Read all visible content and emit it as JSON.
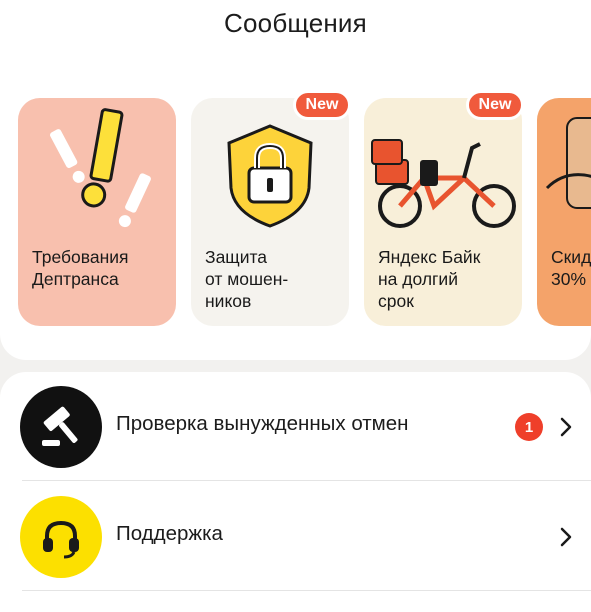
{
  "header": {
    "title": "Сообщения"
  },
  "stories": [
    {
      "caption": "Требования\nДептранса",
      "badge": null,
      "bg": "#f8c0ae",
      "icon": "exclamation-marks-icon"
    },
    {
      "caption": "Защита\nот мошен-\nников",
      "badge": "New",
      "bg": "#f5f3ee",
      "icon": "shield-lock-icon"
    },
    {
      "caption": "Яндекс Байк\nна долгий\nсрок",
      "badge": "New",
      "bg": "#f8efd9",
      "icon": "ebike-icon"
    },
    {
      "caption": "Скид\n30%",
      "badge": null,
      "bg": "#f4a36a",
      "icon": "package-hand-icon"
    }
  ],
  "list": [
    {
      "label": "Проверка вынужденных отмен",
      "count": "1",
      "icon": "gavel-icon",
      "iconBg": "#111111"
    },
    {
      "label": "Поддержка",
      "count": null,
      "icon": "headset-icon",
      "iconBg": "#fce000"
    }
  ],
  "colors": {
    "accent": "#f05a3c",
    "badgeRed": "#ef3f2a",
    "yellow": "#fce000"
  }
}
